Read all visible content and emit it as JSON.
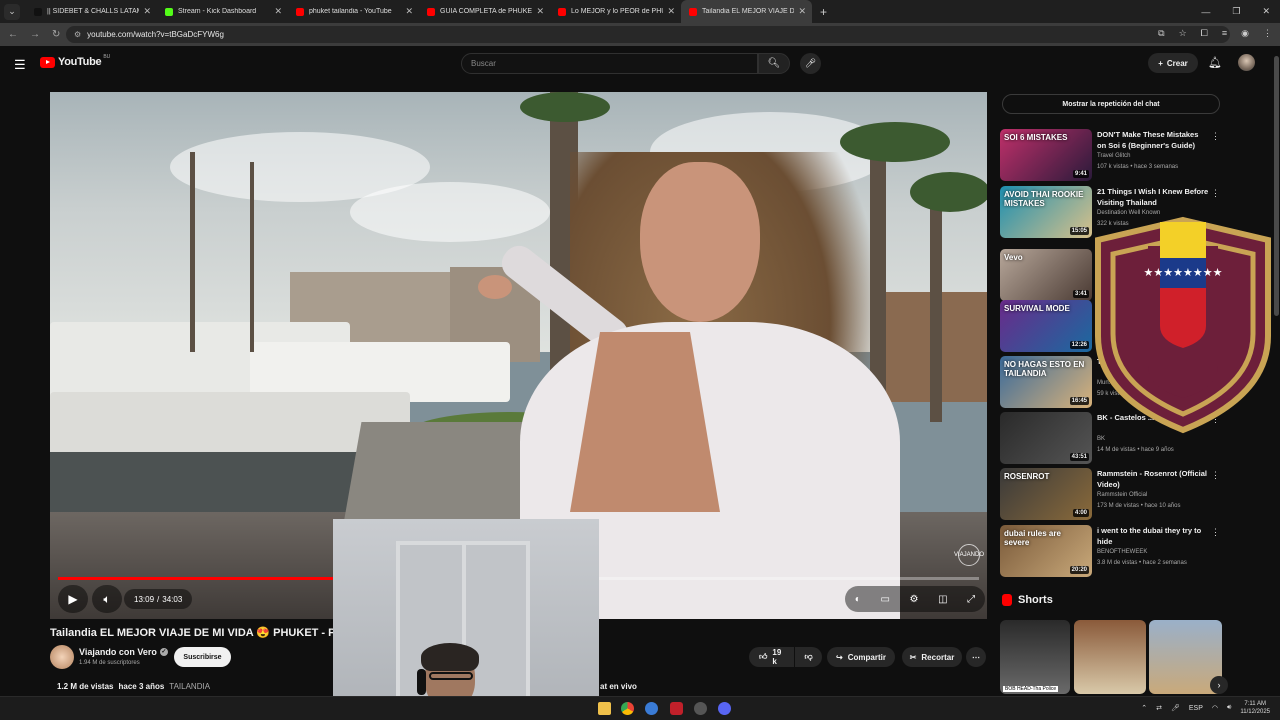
{
  "browser": {
    "tabs": [
      {
        "label": "|| SIDEBET & CHALLS LATAM P...",
        "color": "#111111"
      },
      {
        "label": "Stream - Kick Dashboard",
        "color": "#53fc18"
      },
      {
        "label": "phuket tailandia - YouTube",
        "color": "#ff0000"
      },
      {
        "label": "GUÍA COMPLETA de PHUKE...",
        "color": "#ff0000"
      },
      {
        "label": "Lo MEJOR y lo PEOR de PHUKE...",
        "color": "#ff0000"
      },
      {
        "label": "Tailandia EL MEJOR VIAJE DE M...",
        "color": "#ff0000"
      }
    ],
    "url": "youtube.com/watch?v=tBGaDcFYW6g"
  },
  "header": {
    "logo_text": "YouTube",
    "logo_country": "BU",
    "search_placeholder": "Buscar",
    "create_label": "Crear"
  },
  "player": {
    "current_time": "13:09",
    "separator": "/",
    "duration": "34:03",
    "progress": 0.385,
    "watermark": "VIAJANDO"
  },
  "video": {
    "title": "Tailandia EL MEJOR VIAJE DE MI VIDA 😍 PHUKET - Play",
    "channel": "Viajando con Vero",
    "subscribers": "1.94 M de suscriptores",
    "subscribe_label": "Suscribirse",
    "likes": "19 k",
    "share_label": "Compartir",
    "clip_label": "Recortar",
    "views": "1.2 M de vistas",
    "age": "hace 3 años",
    "hashtag": "TAILANDIA",
    "live_chat_fragment": "at en vivo"
  },
  "sidebar": {
    "chat_button": "Mostrar la repetición del chat",
    "recommendations": [
      {
        "title": "DON'T Make These Mistakes on Soi 6 (Beginner's Guide)",
        "channel": "Travel Glitch",
        "meta": "107 k vistas • hace 3 semanas",
        "duration": "9:41",
        "thumb_text": "SOI 6 MISTAKES",
        "c1": "#c0306a",
        "c2": "#2a1a3a"
      },
      {
        "title": "21 Things I Wish I Knew Before Visiting Thailand",
        "channel": "Destination Well Known",
        "meta": "322 k vistas",
        "duration": "15:05",
        "thumb_text": "AVOID THAI ROOKIE MISTAKES",
        "c1": "#1d8fb0",
        "c2": "#d9c18a"
      },
      {
        "title": "",
        "channel": "",
        "meta": "",
        "duration": "3:41",
        "thumb_text": "Vevo",
        "c1": "#b7a79a",
        "c2": "#4a3a33"
      },
      {
        "title": "",
        "channel": "",
        "meta": "",
        "duration": "12:26",
        "thumb_text": "SURVIVAL MODE",
        "c1": "#6a2a8a",
        "c2": "#1a6aa0"
      },
      {
        "title": "TA...",
        "channel": "Mun...",
        "meta": "59 k vist...",
        "duration": "16:45",
        "thumb_text": "NO HAGAS ESTO EN TAILANDIA",
        "c1": "#3a6a9a",
        "c2": "#d9b27a"
      },
      {
        "title": "BK - Castelos ... Completo)",
        "channel": "BK",
        "meta": "14 M de vistas • hace 9 años",
        "duration": "43:51",
        "thumb_text": "",
        "c1": "#2a2a2a",
        "c2": "#555555"
      },
      {
        "title": "Rammstein - Rosenrot (Official Video)",
        "channel": "Rammstein Official",
        "meta": "173 M de vistas • hace 10 años",
        "duration": "4:00",
        "thumb_text": "ROSENROT",
        "c1": "#3a3a3a",
        "c2": "#8a6a3a"
      },
      {
        "title": "i went to the dubai they try to hide",
        "channel": "BENOFTHEWEEK",
        "meta": "3.8 M de vistas • hace 2 semanas",
        "duration": "20:20",
        "thumb_text": "dubai rules are severe",
        "c1": "#7a5a3a",
        "c2": "#c9a97a"
      }
    ],
    "shorts_title": "Shorts",
    "shorts": [
      {
        "caption": "BOB HEAD-Tha Police",
        "c1": "#2a2a2a",
        "c2": "#6a6a6a"
      },
      {
        "caption": "",
        "c1": "#8a5a3a",
        "c2": "#d9c9a9"
      },
      {
        "caption": "",
        "c1": "#9ab0c9",
        "c2": "#c9a97a"
      }
    ]
  },
  "taskbar": {
    "lang": "ESP",
    "time": "7:11 AM",
    "date": "11/12/2025"
  },
  "colors": {
    "yt_red": "#ff0000",
    "background": "#0f0f0f",
    "crest_maroon": "#6d1f3a",
    "crest_gold": "#c9a454"
  }
}
